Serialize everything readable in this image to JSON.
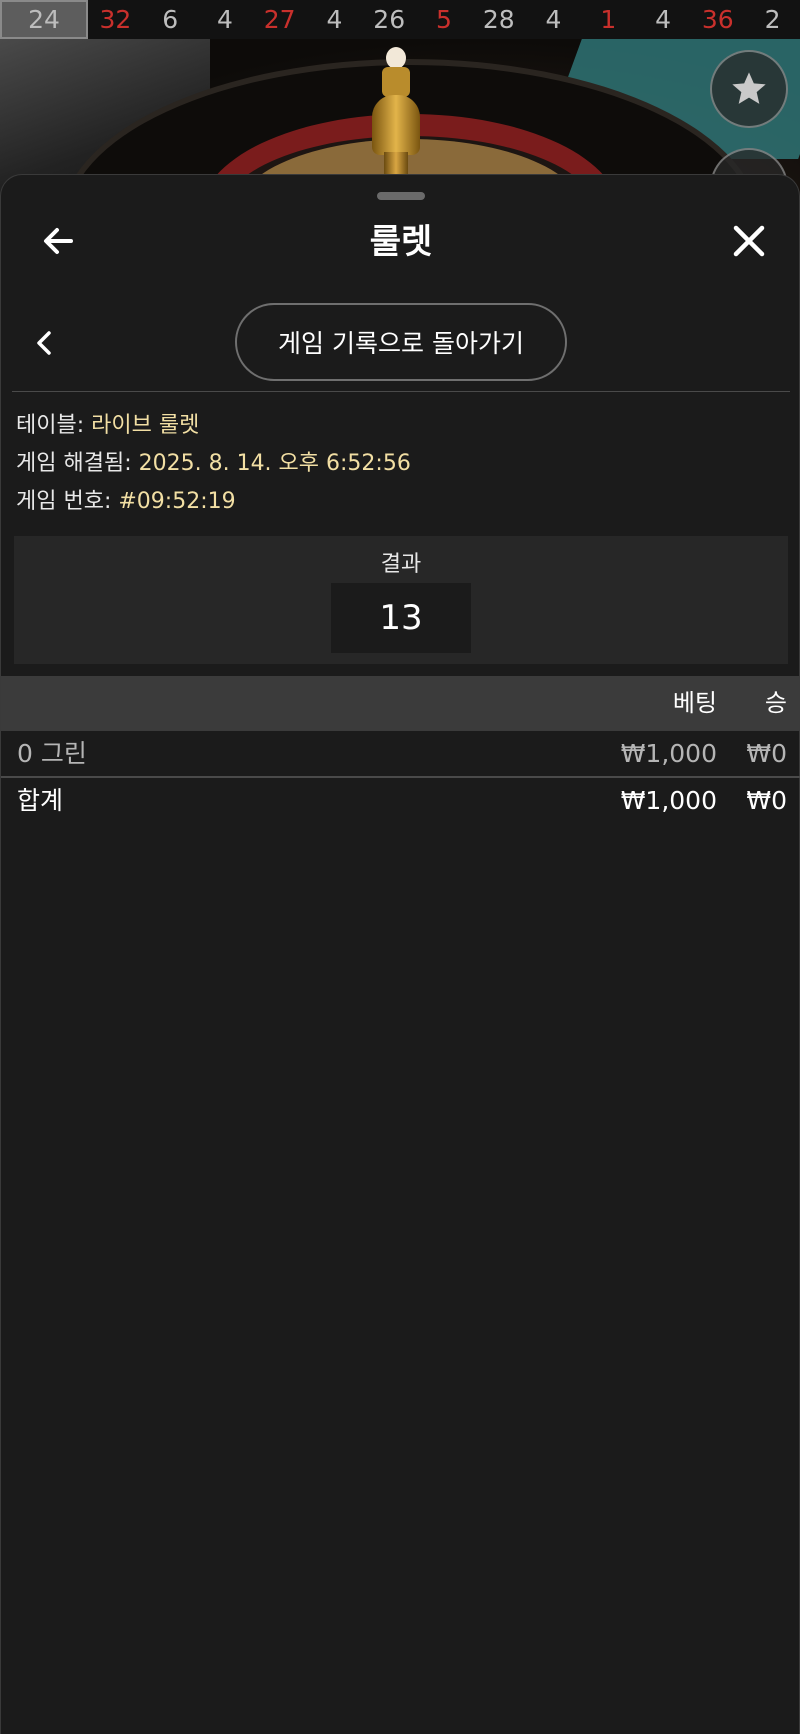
{
  "history": [
    {
      "value": "24",
      "color": "gray",
      "highlight": true
    },
    {
      "value": "32",
      "color": "red"
    },
    {
      "value": "6",
      "color": "gray"
    },
    {
      "value": "4",
      "color": "gray"
    },
    {
      "value": "27",
      "color": "red"
    },
    {
      "value": "4",
      "color": "gray"
    },
    {
      "value": "26",
      "color": "gray"
    },
    {
      "value": "5",
      "color": "red"
    },
    {
      "value": "28",
      "color": "gray"
    },
    {
      "value": "4",
      "color": "gray"
    },
    {
      "value": "1",
      "color": "red"
    },
    {
      "value": "4",
      "color": "gray"
    },
    {
      "value": "36",
      "color": "red"
    },
    {
      "value": "2",
      "color": "gray"
    }
  ],
  "header": {
    "title": "룰렛",
    "back_icon": "arrow-left-icon",
    "close_icon": "close-icon"
  },
  "nav": {
    "back_to_history_label": "게임 기록으로 돌아가기",
    "prev_icon": "chevron-left-icon"
  },
  "info": {
    "table_label": "테이블:",
    "table_value": "라이브 룰렛",
    "resolved_label": "게임 해결됨:",
    "resolved_value": "2025. 8. 14. 오후 6:52:56",
    "number_label": "게임 번호:",
    "number_value": "#09:52:19"
  },
  "result": {
    "label": "결과",
    "number": "13"
  },
  "bets_table": {
    "headers": {
      "bet": "베팅",
      "win": "승"
    },
    "rows": [
      {
        "name": "0 그린",
        "bet": "₩1,000",
        "win": "₩0"
      }
    ],
    "total": {
      "name": "합계",
      "bet": "₩1,000",
      "win": "₩0"
    }
  },
  "colors": {
    "accent_value": "#f2dfa4",
    "red_number": "#c9302c",
    "sheet_bg": "#1b1b1b"
  }
}
